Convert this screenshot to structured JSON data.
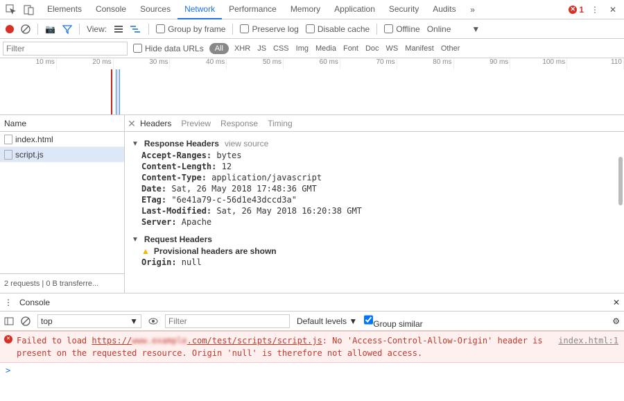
{
  "topTabs": {
    "items": [
      "Elements",
      "Console",
      "Sources",
      "Network",
      "Performance",
      "Memory",
      "Application",
      "Security",
      "Audits"
    ],
    "activeIndex": 3,
    "errorCount": "1"
  },
  "toolbar": {
    "viewLabel": "View:",
    "groupByFrame": "Group by frame",
    "preserveLog": "Preserve log",
    "disableCache": "Disable cache",
    "offline": "Offline",
    "online": "Online"
  },
  "filterBar": {
    "filterPlaceholder": "Filter",
    "hideDataUrls": "Hide data URLs",
    "all": "All",
    "types": [
      "XHR",
      "JS",
      "CSS",
      "Img",
      "Media",
      "Font",
      "Doc",
      "WS",
      "Manifest",
      "Other"
    ]
  },
  "timeline": {
    "ticks": [
      "10 ms",
      "20 ms",
      "30 ms",
      "40 ms",
      "50 ms",
      "60 ms",
      "70 ms",
      "80 ms",
      "90 ms",
      "100 ms",
      "110"
    ]
  },
  "nameCol": {
    "header": "Name",
    "rows": [
      {
        "name": "index.html",
        "selected": false
      },
      {
        "name": "script.js",
        "selected": true
      }
    ],
    "status": "2 requests  |  0 B transferre..."
  },
  "detail": {
    "tabs": [
      "Headers",
      "Preview",
      "Response",
      "Timing"
    ],
    "activeTab": 0,
    "responseHeaders": {
      "title": "Response Headers",
      "viewSource": "view source",
      "items": [
        {
          "k": "Accept-Ranges:",
          "v": "bytes"
        },
        {
          "k": "Content-Length:",
          "v": "12"
        },
        {
          "k": "Content-Type:",
          "v": "application/javascript"
        },
        {
          "k": "Date:",
          "v": "Sat, 26 May 2018 17:48:36 GMT"
        },
        {
          "k": "ETag:",
          "v": "\"6e41a79-c-56d1e43dccd3a\""
        },
        {
          "k": "Last-Modified:",
          "v": "Sat, 26 May 2018 16:20:38 GMT"
        },
        {
          "k": "Server:",
          "v": "Apache"
        }
      ]
    },
    "requestHeaders": {
      "title": "Request Headers",
      "warning": "Provisional headers are shown",
      "items": [
        {
          "k": "Origin:",
          "v": "null"
        }
      ]
    }
  },
  "console": {
    "drawerTitle": "Console",
    "context": "top",
    "filterPlaceholder": "Filter",
    "levels": "Default levels",
    "groupSimilar": "Group similar",
    "error": {
      "prefix": "Failed to load ",
      "urlPre": "https://",
      "urlBlur": "www.example",
      "urlPost": ".com/test/scripts/script.js",
      "rest": ": No 'Access-Control-Allow-Origin' header is present on the requested resource. Origin 'null' is therefore not allowed access.",
      "location": "index.html:1"
    },
    "prompt": ">"
  }
}
